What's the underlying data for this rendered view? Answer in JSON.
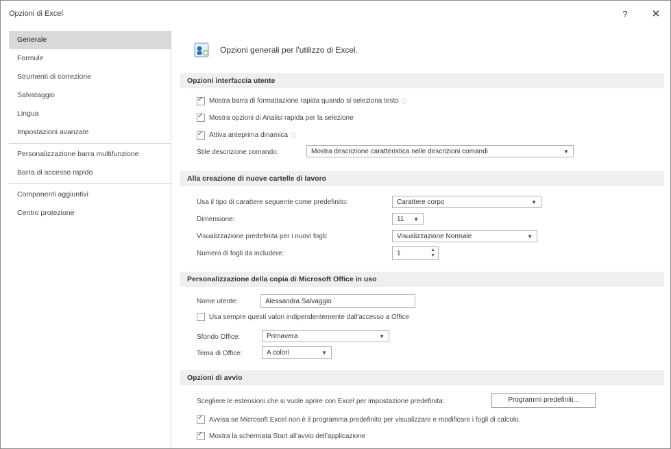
{
  "window": {
    "title": "Opzioni di Excel",
    "help": "?",
    "close": "✕"
  },
  "sidebar": {
    "items": [
      "Generale",
      "Formule",
      "Strumenti di correzione",
      "Salvataggio",
      "Lingua",
      "Impostazioni avanzate",
      "Personalizzazione barra multifunzione",
      "Barra di accesso rapido",
      "Componenti aggiuntivi",
      "Centro protezione"
    ],
    "selected": "Generale"
  },
  "header": {
    "text": "Opzioni generali per l'utilizzo di Excel."
  },
  "ui_options": {
    "title": "Opzioni interfaccia utente",
    "mini_toolbar": "Mostra barra di formattazione rapida quando si seleziona testo",
    "quick_analysis": "Mostra opzioni di Analisi rapida per la selezione",
    "live_preview": "Attiva anteprima dinamica",
    "tooltip_label": "Stile descrizione comando:",
    "tooltip_value": "Mostra descrizione caratteristica nelle descrizioni comandi"
  },
  "new_workbook": {
    "title": "Alla creazione di nuove cartelle di lavoro",
    "font_label": "Usa il tipo di carattere seguente come predefinito:",
    "font_value": "Carattere corpo",
    "size_label": "Dimensione:",
    "size_value": "11",
    "view_label": "Visualizzazione predefinita per i nuovi fogli:",
    "view_value": "Visualizzazione Normale",
    "sheets_label": "Numero di fogli da includere:",
    "sheets_value": "1"
  },
  "personalize": {
    "title": "Personalizzazione della copia di Microsoft Office in uso",
    "username_label": "Nome utente:",
    "username_value": "Alessandra Salvaggio",
    "always_use": "Usa sempre questi valori indipendentemente dall'accesso a Office",
    "background_label": "Sfondo Office:",
    "background_value": "Primavera",
    "theme_label": "Tema di Office:",
    "theme_value": "A colori"
  },
  "startup": {
    "title": "Opzioni di avvio",
    "extensions_label": "Scegliere le estensioni che si vuole aprire con Excel per impostazione predefinita:",
    "default_programs": "Programmi predefiniti...",
    "warn_default": "Avvisa se Microsoft Excel non è il programma predefinito per visualizzare e modificare i fogli di calcolo.",
    "show_start": "Mostra la schermata Start all'avvio dell'applicazione"
  },
  "colors": {
    "accent": "#2b6cb0",
    "selected_nav": "#d9d9d9",
    "section_bg": "#efefef"
  }
}
